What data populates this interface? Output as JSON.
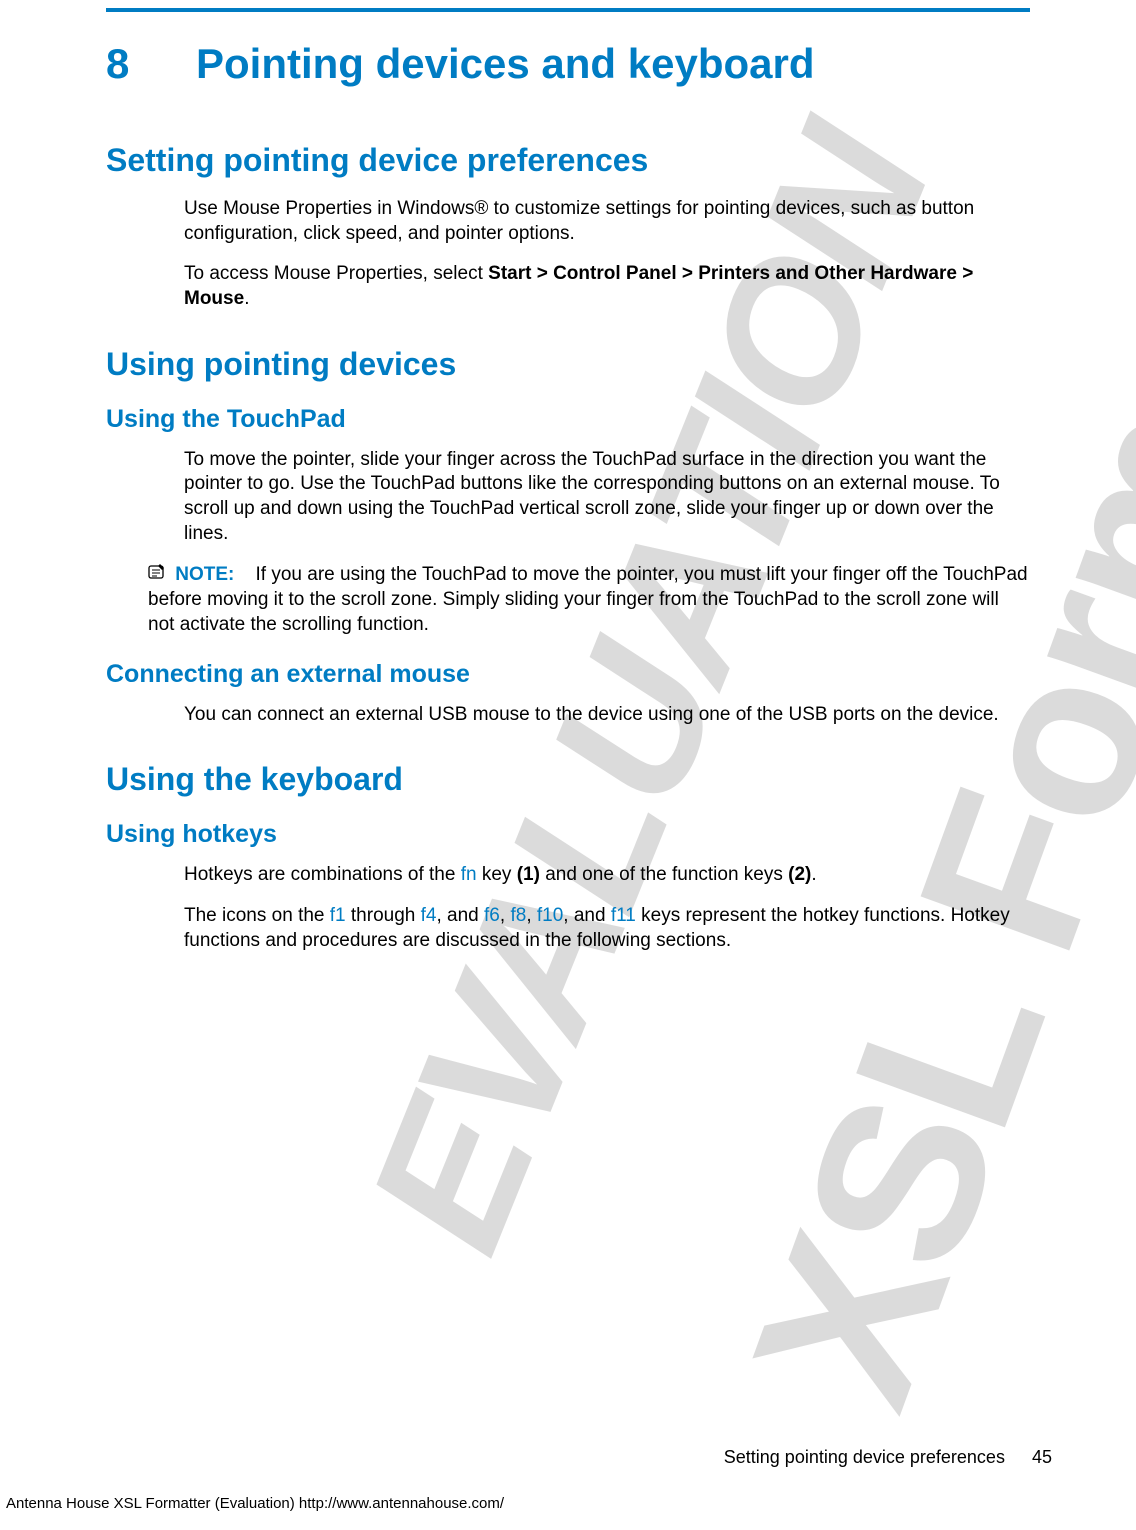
{
  "watermark": {
    "line1": "XSL Formatter",
    "line2": "EVALUATION"
  },
  "chapter": {
    "number": "8",
    "title": "Pointing devices and keyboard"
  },
  "section1": {
    "title": "Setting pointing device preferences",
    "p1": "Use Mouse Properties in Windows® to customize settings for pointing devices, such as button configuration, click speed, and pointer options.",
    "p2a": "To access Mouse Properties, select ",
    "p2b": "Start > Control Panel > Printers and Other Hardware > Mouse",
    "p2c": "."
  },
  "section2": {
    "title": "Using pointing devices",
    "sub1": {
      "title": "Using the TouchPad",
      "p1": "To move the pointer, slide your finger across the TouchPad surface in the direction you want the pointer to go. Use the TouchPad buttons like the corresponding buttons on an external mouse. To scroll up and down using the TouchPad vertical scroll zone, slide your finger up or down over the lines.",
      "note_label": "NOTE:",
      "note_text": "If you are using the TouchPad to move the pointer, you must lift your finger off the TouchPad before moving it to the scroll zone. Simply sliding your finger from the TouchPad to the scroll zone will not activate the scrolling function."
    },
    "sub2": {
      "title": "Connecting an external mouse",
      "p1": "You can connect an external USB mouse to the device using one of the USB ports on the device."
    }
  },
  "section3": {
    "title": "Using the keyboard",
    "sub1": {
      "title": "Using hotkeys",
      "p1a": "Hotkeys are combinations of the ",
      "key_fn": "fn",
      "p1b": " key ",
      "bold1": "(1)",
      "p1c": " and one of the function keys ",
      "bold2": "(2)",
      "p1d": ".",
      "p2a": "The icons on the ",
      "key_f1": "f1",
      "p2b": " through ",
      "key_f4": "f4",
      "p2c": ", and ",
      "key_f6": "f6",
      "p2d": ", ",
      "key_f8": "f8",
      "p2e": ", ",
      "key_f10": "f10",
      "p2f": ", and ",
      "key_f11": "f11",
      "p2g": " keys represent the hotkey functions. Hotkey functions and procedures are discussed in the following sections."
    }
  },
  "footer": {
    "section_ref": "Setting pointing device preferences",
    "page": "45",
    "generator": "Antenna House XSL Formatter (Evaluation)  http://www.antennahouse.com/"
  }
}
